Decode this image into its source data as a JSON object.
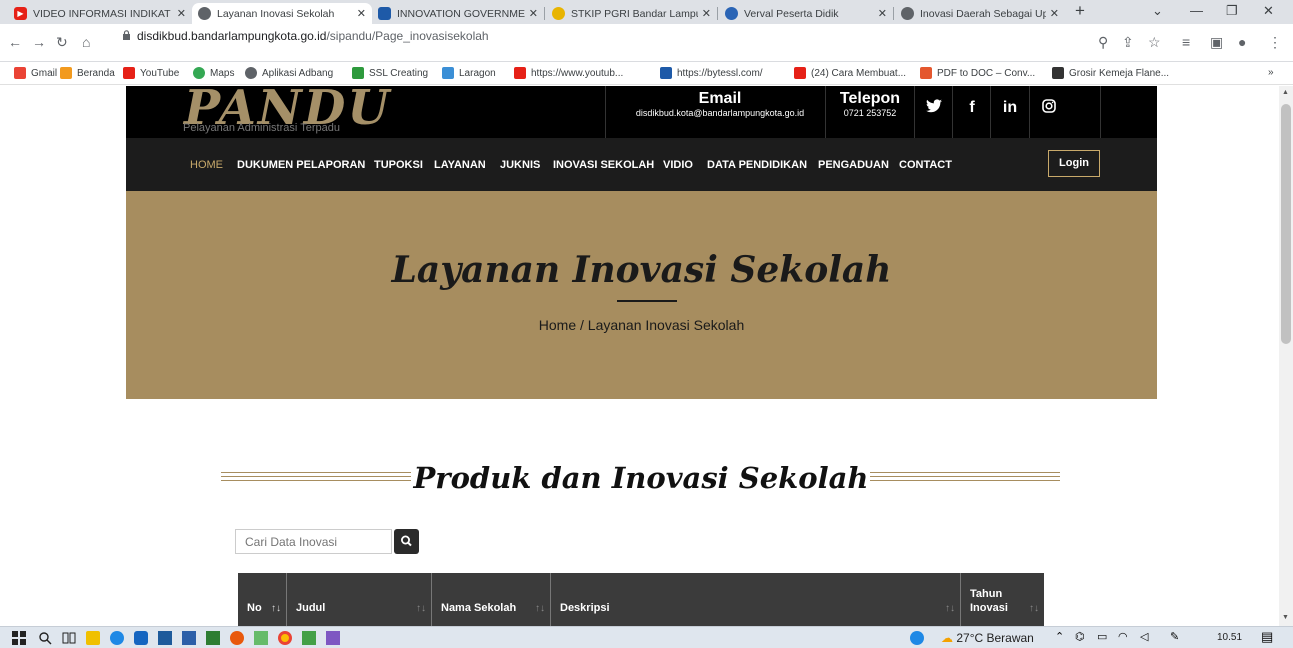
{
  "browser": {
    "tabs": [
      {
        "label": "VIDEO INFORMASI INDIKAT",
        "icon": "youtube-icon",
        "active": false
      },
      {
        "label": "Layanan Inovasi Sekolah",
        "icon": "globe-icon",
        "active": true
      },
      {
        "label": "INNOVATION GOVERNMEN",
        "icon": "site-icon",
        "active": false
      },
      {
        "label": "STKIP PGRI Bandar Lampun",
        "icon": "site-icon",
        "active": false
      },
      {
        "label": "Verval Peserta Didik",
        "icon": "site-icon",
        "active": false
      },
      {
        "label": "Inovasi Daerah Sebagai Up",
        "icon": "globe-icon",
        "active": false
      }
    ],
    "new_tab": "+",
    "url_host": "disdikbud.bandarlampungkota.go.id",
    "url_path": "/sipandu/Page_inovasisekolah",
    "bookmarks": [
      "Gmail",
      "Beranda",
      "YouTube",
      "Maps",
      "Aplikasi Adbang",
      "SSL Creating",
      "Laragon",
      "https://www.youtub...",
      "https://bytessl.com/",
      "(24) Cara Membuat...",
      "PDF to DOC – Conv...",
      "Grosir Kemeja Flane..."
    ],
    "bookmarks_more": "»"
  },
  "site": {
    "logo": "PANDU",
    "logo_sub": "Pelayanan Administrasi Terpadu",
    "email_label": "Email",
    "email_value": "disdikbud.kota@bandarlampungkota.go.id",
    "phone_label": "Telepon",
    "phone_value": "0721 253752",
    "social": [
      "twitter-icon",
      "facebook-icon",
      "linkedin-icon",
      "instagram-icon"
    ],
    "social_text": {
      "facebook": "f",
      "linkedin": "in"
    },
    "nav": [
      "HOME",
      "DUKUMEN PELAPORAN",
      "TUPOKSI",
      "LAYANAN",
      "JUKNIS",
      "INOVASI SEKOLAH",
      "VIDIO",
      "DATA PENDIDIKAN",
      "PENGADUAN",
      "CONTACT"
    ],
    "login": "Login"
  },
  "hero": {
    "title": "Layanan Inovasi Sekolah",
    "breadcrumb": "Home  /  Layanan Inovasi Sekolah"
  },
  "section": {
    "title": "Produk dan Inovasi Sekolah",
    "search_placeholder": "Cari Data Inovasi"
  },
  "table": {
    "columns": [
      "No",
      "Judul",
      "Nama Sekolah",
      "Deskripsi",
      "Tahun Inovasi"
    ],
    "col_no_line": "No ↑↓",
    "tahun_line1": "Tahun",
    "tahun_line2": "Inovasi",
    "sort_glyph": "↑↓"
  },
  "taskbar": {
    "weather": "27°C  Berawan",
    "time": "10.51"
  },
  "colors": {
    "gold": "#a78d5f",
    "dark": "#1c1c1c",
    "accent_nav": "#c8a96a"
  }
}
